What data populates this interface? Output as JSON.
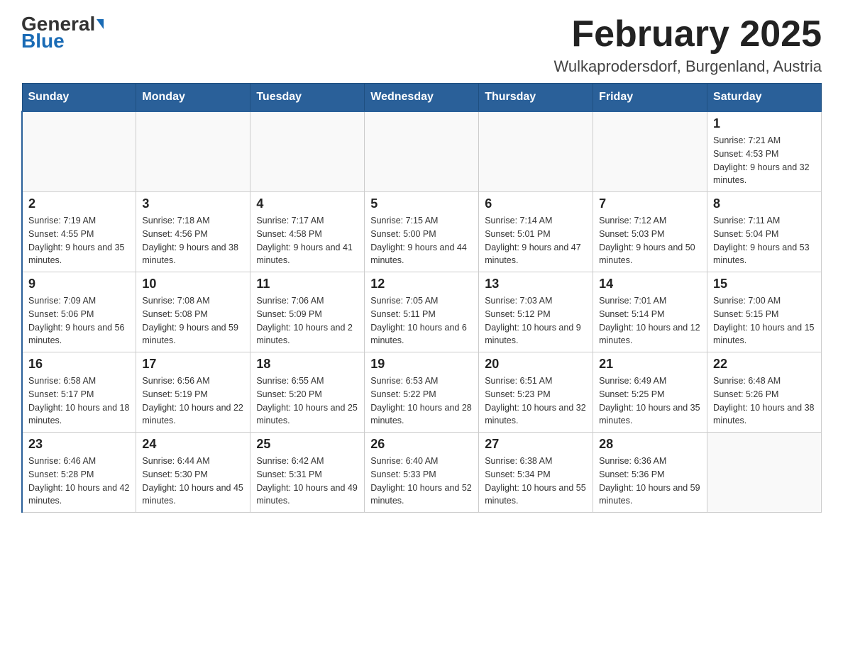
{
  "header": {
    "logo_main": "General",
    "logo_sub": "Blue",
    "month_title": "February 2025",
    "location": "Wulkaprodersdorf, Burgenland, Austria"
  },
  "weekdays": [
    "Sunday",
    "Monday",
    "Tuesday",
    "Wednesday",
    "Thursday",
    "Friday",
    "Saturday"
  ],
  "weeks": [
    [
      {
        "day": "",
        "info": ""
      },
      {
        "day": "",
        "info": ""
      },
      {
        "day": "",
        "info": ""
      },
      {
        "day": "",
        "info": ""
      },
      {
        "day": "",
        "info": ""
      },
      {
        "day": "",
        "info": ""
      },
      {
        "day": "1",
        "info": "Sunrise: 7:21 AM\nSunset: 4:53 PM\nDaylight: 9 hours and 32 minutes."
      }
    ],
    [
      {
        "day": "2",
        "info": "Sunrise: 7:19 AM\nSunset: 4:55 PM\nDaylight: 9 hours and 35 minutes."
      },
      {
        "day": "3",
        "info": "Sunrise: 7:18 AM\nSunset: 4:56 PM\nDaylight: 9 hours and 38 minutes."
      },
      {
        "day": "4",
        "info": "Sunrise: 7:17 AM\nSunset: 4:58 PM\nDaylight: 9 hours and 41 minutes."
      },
      {
        "day": "5",
        "info": "Sunrise: 7:15 AM\nSunset: 5:00 PM\nDaylight: 9 hours and 44 minutes."
      },
      {
        "day": "6",
        "info": "Sunrise: 7:14 AM\nSunset: 5:01 PM\nDaylight: 9 hours and 47 minutes."
      },
      {
        "day": "7",
        "info": "Sunrise: 7:12 AM\nSunset: 5:03 PM\nDaylight: 9 hours and 50 minutes."
      },
      {
        "day": "8",
        "info": "Sunrise: 7:11 AM\nSunset: 5:04 PM\nDaylight: 9 hours and 53 minutes."
      }
    ],
    [
      {
        "day": "9",
        "info": "Sunrise: 7:09 AM\nSunset: 5:06 PM\nDaylight: 9 hours and 56 minutes."
      },
      {
        "day": "10",
        "info": "Sunrise: 7:08 AM\nSunset: 5:08 PM\nDaylight: 9 hours and 59 minutes."
      },
      {
        "day": "11",
        "info": "Sunrise: 7:06 AM\nSunset: 5:09 PM\nDaylight: 10 hours and 2 minutes."
      },
      {
        "day": "12",
        "info": "Sunrise: 7:05 AM\nSunset: 5:11 PM\nDaylight: 10 hours and 6 minutes."
      },
      {
        "day": "13",
        "info": "Sunrise: 7:03 AM\nSunset: 5:12 PM\nDaylight: 10 hours and 9 minutes."
      },
      {
        "day": "14",
        "info": "Sunrise: 7:01 AM\nSunset: 5:14 PM\nDaylight: 10 hours and 12 minutes."
      },
      {
        "day": "15",
        "info": "Sunrise: 7:00 AM\nSunset: 5:15 PM\nDaylight: 10 hours and 15 minutes."
      }
    ],
    [
      {
        "day": "16",
        "info": "Sunrise: 6:58 AM\nSunset: 5:17 PM\nDaylight: 10 hours and 18 minutes."
      },
      {
        "day": "17",
        "info": "Sunrise: 6:56 AM\nSunset: 5:19 PM\nDaylight: 10 hours and 22 minutes."
      },
      {
        "day": "18",
        "info": "Sunrise: 6:55 AM\nSunset: 5:20 PM\nDaylight: 10 hours and 25 minutes."
      },
      {
        "day": "19",
        "info": "Sunrise: 6:53 AM\nSunset: 5:22 PM\nDaylight: 10 hours and 28 minutes."
      },
      {
        "day": "20",
        "info": "Sunrise: 6:51 AM\nSunset: 5:23 PM\nDaylight: 10 hours and 32 minutes."
      },
      {
        "day": "21",
        "info": "Sunrise: 6:49 AM\nSunset: 5:25 PM\nDaylight: 10 hours and 35 minutes."
      },
      {
        "day": "22",
        "info": "Sunrise: 6:48 AM\nSunset: 5:26 PM\nDaylight: 10 hours and 38 minutes."
      }
    ],
    [
      {
        "day": "23",
        "info": "Sunrise: 6:46 AM\nSunset: 5:28 PM\nDaylight: 10 hours and 42 minutes."
      },
      {
        "day": "24",
        "info": "Sunrise: 6:44 AM\nSunset: 5:30 PM\nDaylight: 10 hours and 45 minutes."
      },
      {
        "day": "25",
        "info": "Sunrise: 6:42 AM\nSunset: 5:31 PM\nDaylight: 10 hours and 49 minutes."
      },
      {
        "day": "26",
        "info": "Sunrise: 6:40 AM\nSunset: 5:33 PM\nDaylight: 10 hours and 52 minutes."
      },
      {
        "day": "27",
        "info": "Sunrise: 6:38 AM\nSunset: 5:34 PM\nDaylight: 10 hours and 55 minutes."
      },
      {
        "day": "28",
        "info": "Sunrise: 6:36 AM\nSunset: 5:36 PM\nDaylight: 10 hours and 59 minutes."
      },
      {
        "day": "",
        "info": ""
      }
    ]
  ]
}
